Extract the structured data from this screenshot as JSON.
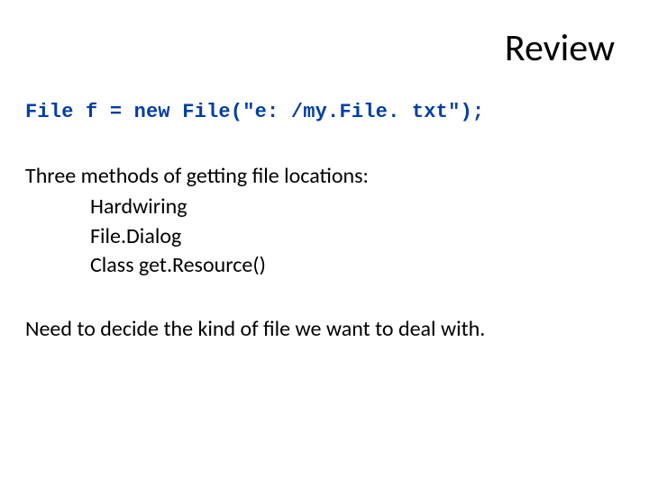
{
  "title": "Review",
  "code": "File f = new File(\"e: /my.File. txt\");",
  "body": {
    "intro": "Three methods of getting file locations:",
    "methods": [
      "Hardwiring",
      "File.Dialog",
      "Class get.Resource()"
    ],
    "closing": "Need to decide the kind of file we want to deal with."
  }
}
